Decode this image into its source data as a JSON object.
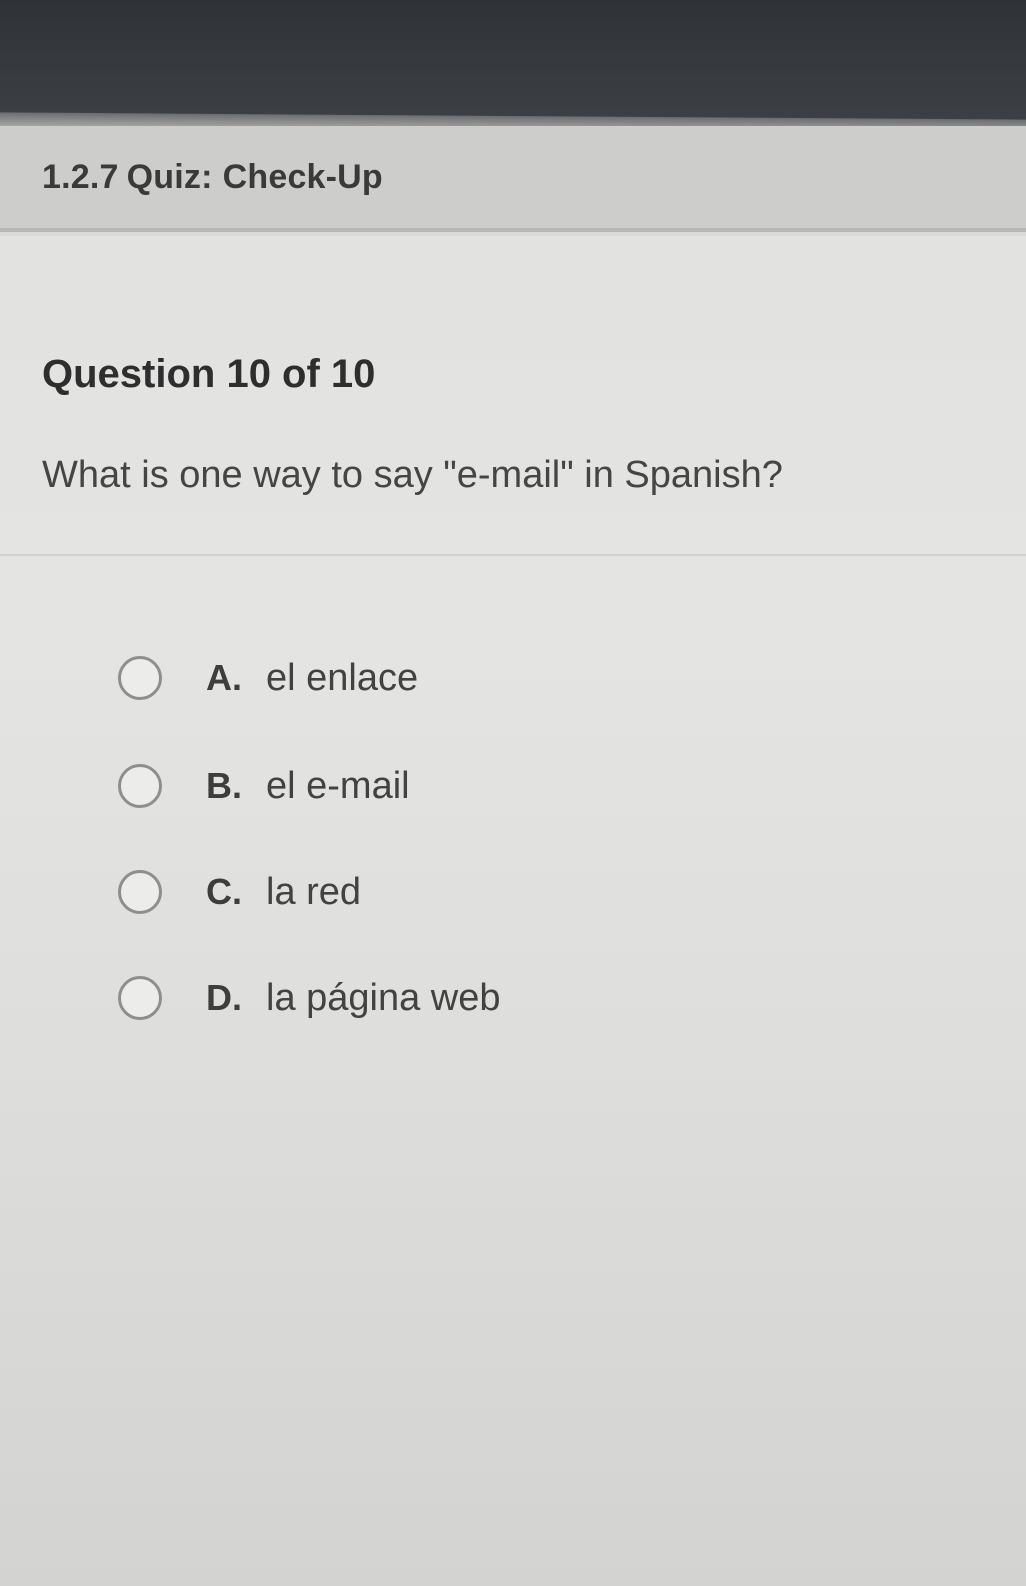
{
  "quiz": {
    "number": "1.2.7",
    "type": "Quiz:",
    "name": "Check-Up"
  },
  "question": {
    "counter": "Question 10 of 10",
    "prompt": "What is one way to say \"e-mail\" in Spanish?"
  },
  "options": [
    {
      "letter": "A.",
      "text": "el enlace"
    },
    {
      "letter": "B.",
      "text": "el e-mail"
    },
    {
      "letter": "C.",
      "text": "la red"
    },
    {
      "letter": "D.",
      "text": "la página web"
    }
  ]
}
